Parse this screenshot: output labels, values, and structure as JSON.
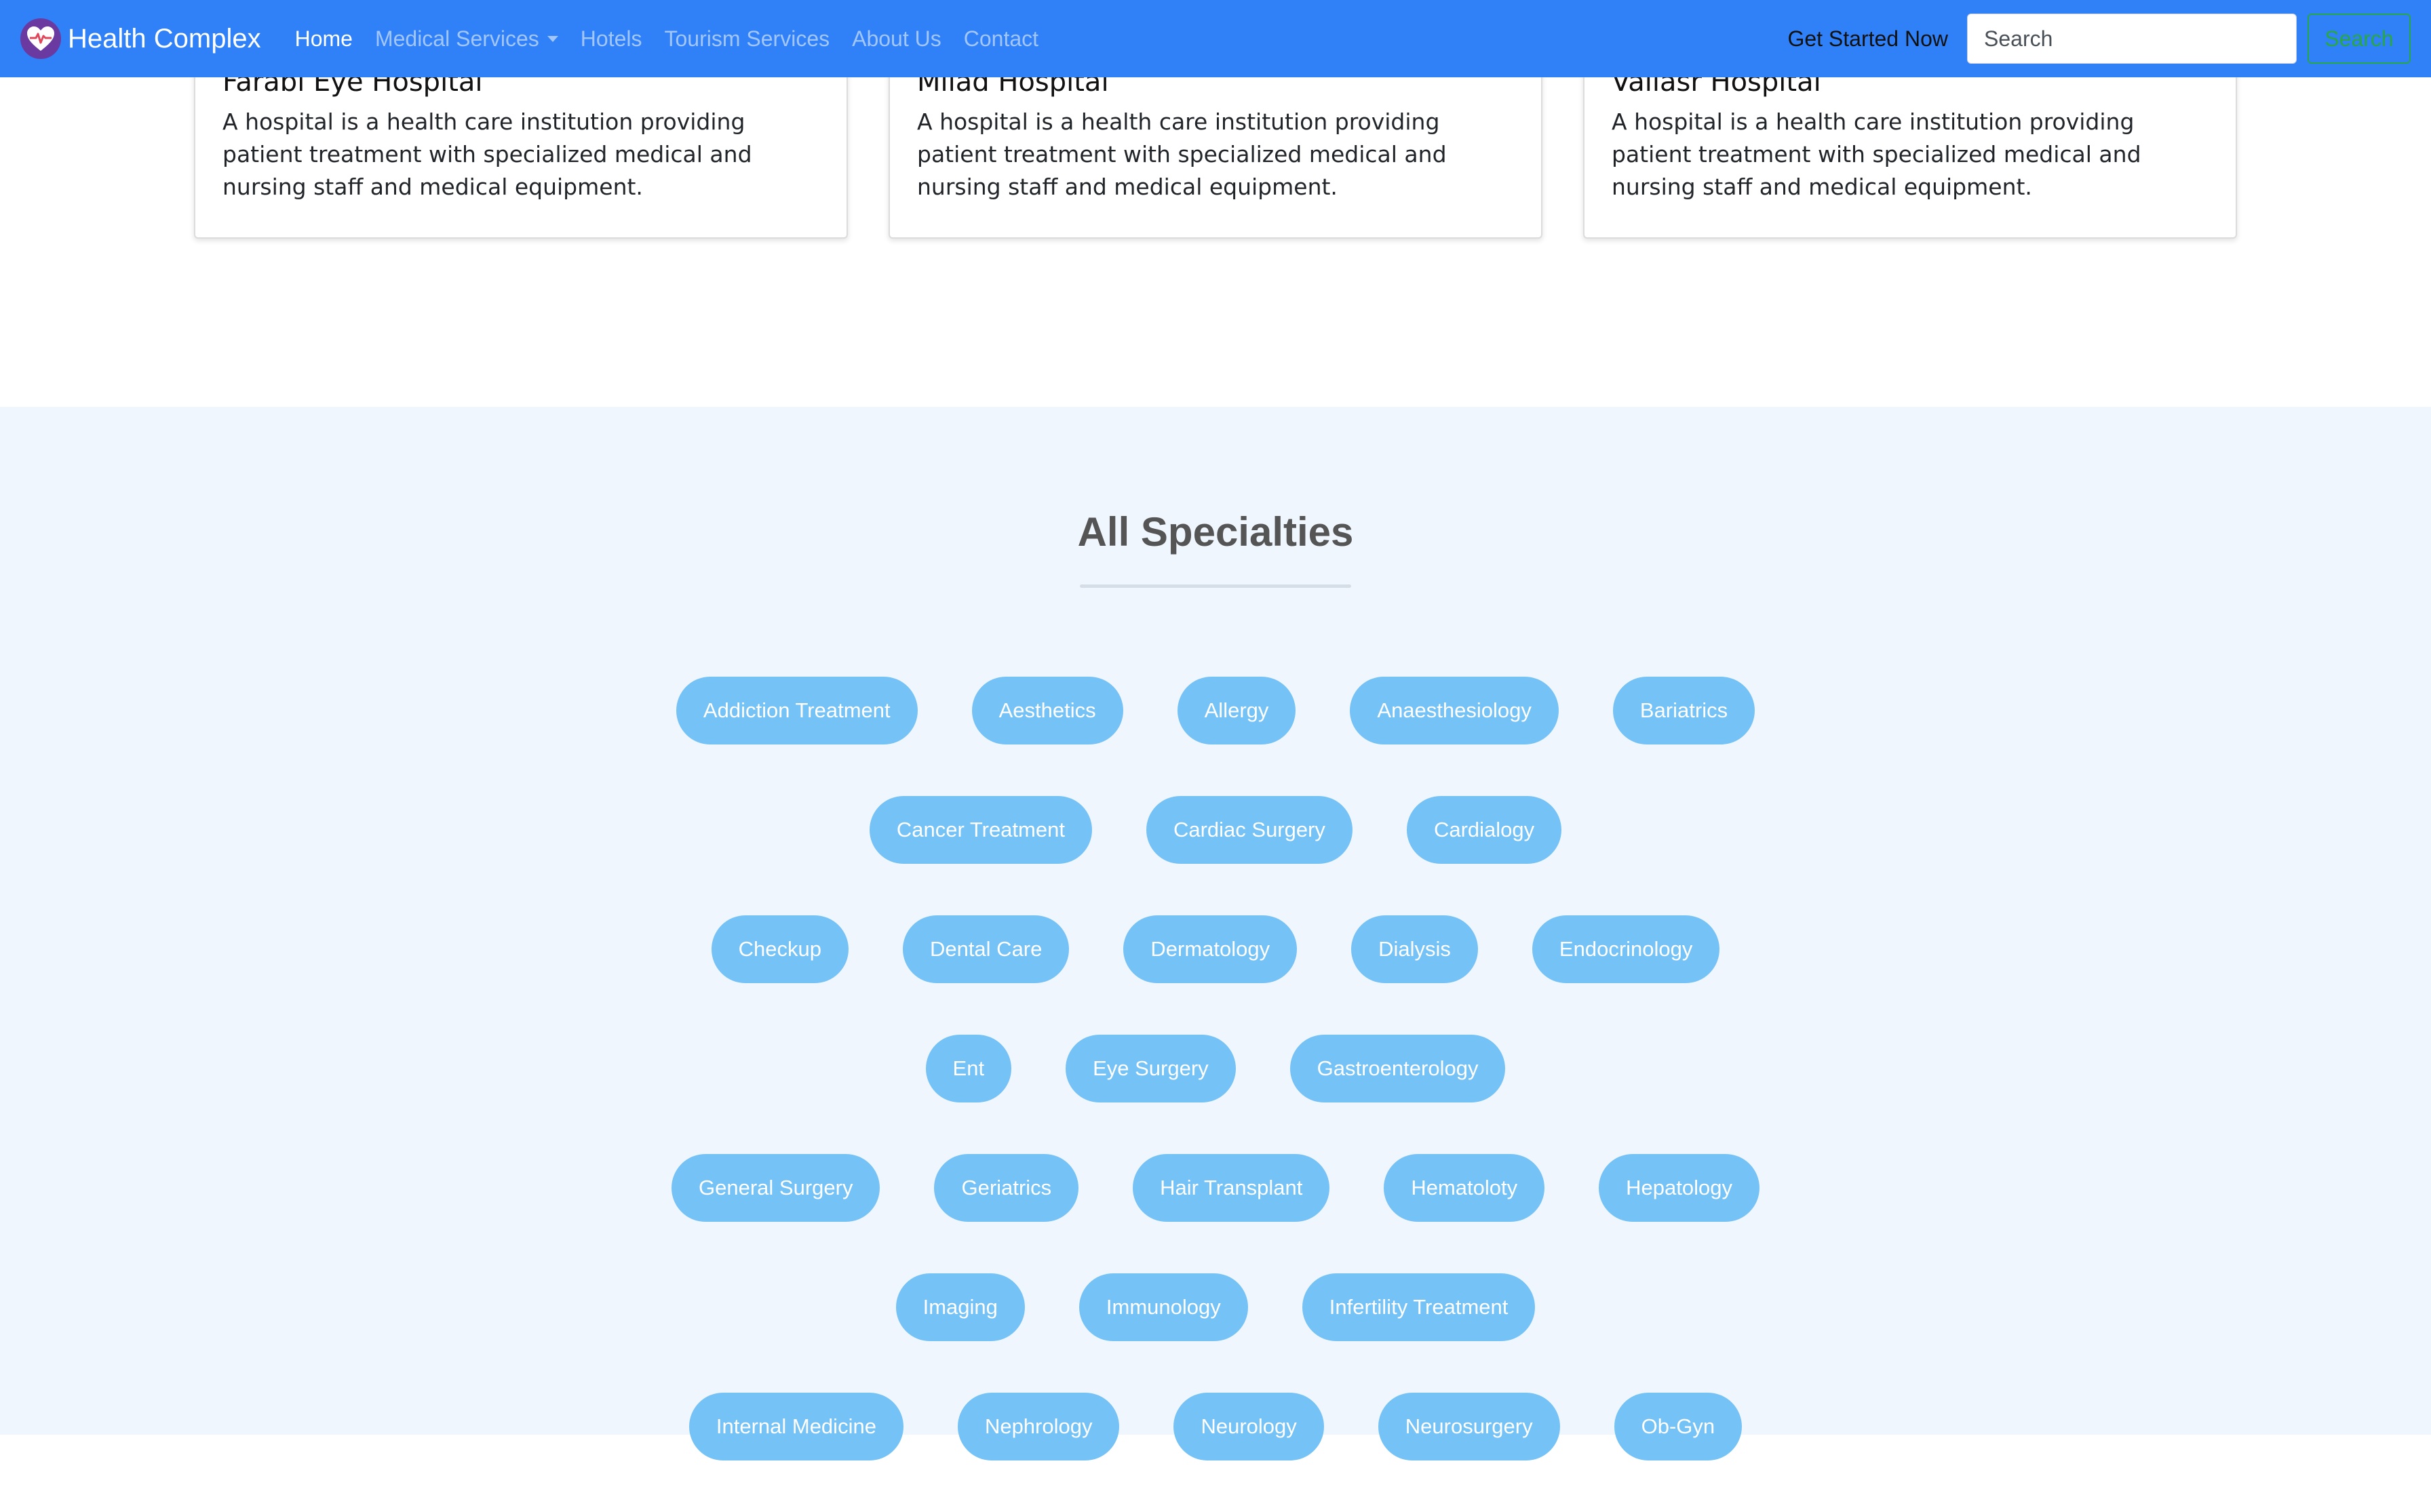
{
  "navbar": {
    "brand": "Health Complex",
    "links": [
      "Home",
      "Medical Services",
      "Hotels",
      "Tourism Services",
      "About Us",
      "Contact"
    ],
    "cta": "Get Started Now",
    "search_placeholder": "Search",
    "search_button": "Search",
    "brand_color": "#3080f8"
  },
  "hospitals": [
    {
      "name": "Farabi Eye Hospital",
      "description": "A hospital is a health care institution providing patient treatment with specialized medical and nursing staff and medical equipment."
    },
    {
      "name": "Milad Hospital",
      "description": "A hospital is a health care institution providing patient treatment with specialized medical and nursing staff and medical equipment."
    },
    {
      "name": "Valiasr Hospital",
      "description": "A hospital is a health care institution providing patient treatment with specialized medical and nursing staff and medical equipment."
    }
  ],
  "specialties": {
    "title": "All Specialties",
    "rows": [
      [
        "Addiction Treatment",
        "Aesthetics",
        "Allergy",
        "Anaesthesiology",
        "Bariatrics"
      ],
      [
        "Cancer Treatment",
        "Cardiac Surgery",
        "Cardialogy"
      ],
      [
        "Checkup",
        "Dental Care",
        "Dermatology",
        "Dialysis",
        "Endocrinology"
      ],
      [
        "Ent",
        "Eye Surgery",
        "Gastroenterology"
      ],
      [
        "General Surgery",
        "Geriatrics",
        "Hair Transplant",
        "Hematoloty",
        "Hepatology"
      ],
      [
        "Imaging",
        "Immunology",
        "Infertility Treatment"
      ],
      [
        "Internal Medicine",
        "Nephrology",
        "Neurology",
        "Neurosurgery",
        "Ob-Gyn"
      ]
    ],
    "pill_color": "#75c2f6",
    "section_bg": "#eff6fd"
  }
}
